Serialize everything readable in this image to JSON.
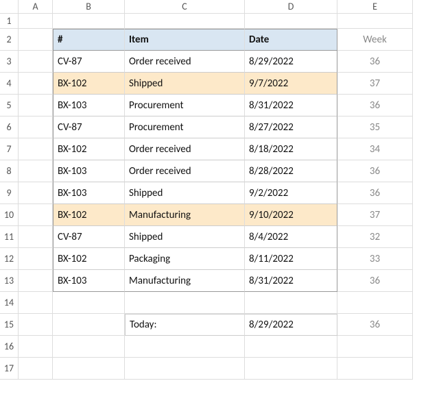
{
  "columns": [
    "A",
    "B",
    "C",
    "D",
    "E"
  ],
  "headers": {
    "b": "#",
    "c": "Item",
    "d": "Date",
    "e": "Week"
  },
  "rows": [
    {
      "num": "CV-87",
      "item": "Order received",
      "date": "8/29/2022",
      "week": "36",
      "hl": false
    },
    {
      "num": "BX-102",
      "item": "Shipped",
      "date": "9/7/2022",
      "week": "37",
      "hl": true
    },
    {
      "num": "BX-103",
      "item": "Procurement",
      "date": "8/31/2022",
      "week": "36",
      "hl": false
    },
    {
      "num": "CV-87",
      "item": "Procurement",
      "date": "8/27/2022",
      "week": "35",
      "hl": false
    },
    {
      "num": "BX-102",
      "item": "Order received",
      "date": "8/18/2022",
      "week": "34",
      "hl": false
    },
    {
      "num": "BX-103",
      "item": "Order received",
      "date": "8/28/2022",
      "week": "36",
      "hl": false
    },
    {
      "num": "BX-103",
      "item": "Shipped",
      "date": "9/2/2022",
      "week": "36",
      "hl": false
    },
    {
      "num": "BX-102",
      "item": "Manufacturing",
      "date": "9/10/2022",
      "week": "37",
      "hl": true
    },
    {
      "num": "CV-87",
      "item": "Shipped",
      "date": "8/4/2022",
      "week": "32",
      "hl": false
    },
    {
      "num": "BX-102",
      "item": "Packaging",
      "date": "8/11/2022",
      "week": "33",
      "hl": false
    },
    {
      "num": "BX-103",
      "item": "Manufacturing",
      "date": "8/31/2022",
      "week": "36",
      "hl": false
    }
  ],
  "today": {
    "label": "Today:",
    "date": "8/29/2022",
    "week": "36"
  }
}
